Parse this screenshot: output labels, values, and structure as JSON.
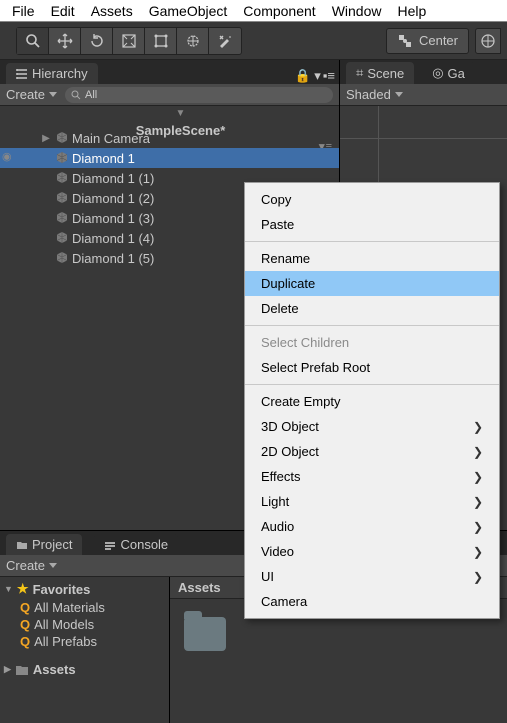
{
  "menubar": [
    "File",
    "Edit",
    "Assets",
    "GameObject",
    "Component",
    "Window",
    "Help"
  ],
  "toolbar": {
    "center_label": "Center"
  },
  "hierarchy": {
    "tab": "Hierarchy",
    "create_label": "Create",
    "search_placeholder": "All",
    "scene": "SampleScene*",
    "nodes": [
      {
        "label": "Main Camera",
        "selected": false,
        "has_arrow": true
      },
      {
        "label": "Diamond 1",
        "selected": true,
        "has_arrow": false
      },
      {
        "label": "Diamond 1 (1)",
        "selected": false,
        "has_arrow": false
      },
      {
        "label": "Diamond 1 (2)",
        "selected": false,
        "has_arrow": false
      },
      {
        "label": "Diamond 1 (3)",
        "selected": false,
        "has_arrow": false
      },
      {
        "label": "Diamond 1 (4)",
        "selected": false,
        "has_arrow": false
      },
      {
        "label": "Diamond 1 (5)",
        "selected": false,
        "has_arrow": false
      }
    ]
  },
  "scene_panel": {
    "tab": "Scene",
    "g_tab": "Ga",
    "shading": "Shaded"
  },
  "project": {
    "tab1": "Project",
    "tab2": "Console",
    "create_label": "Create",
    "favorites_label": "Favorites",
    "fav_items": [
      "All Materials",
      "All Models",
      "All Prefabs"
    ],
    "assets_label": "Assets",
    "assets_breadcrumb": "Assets"
  },
  "context_menu": {
    "groups": [
      [
        {
          "label": "Copy"
        },
        {
          "label": "Paste"
        }
      ],
      [
        {
          "label": "Rename"
        },
        {
          "label": "Duplicate",
          "hl": true
        },
        {
          "label": "Delete"
        }
      ],
      [
        {
          "label": "Select Children",
          "disabled": true
        },
        {
          "label": "Select Prefab Root"
        }
      ],
      [
        {
          "label": "Create Empty"
        },
        {
          "label": "3D Object",
          "sub": true
        },
        {
          "label": "2D Object",
          "sub": true
        },
        {
          "label": "Effects",
          "sub": true
        },
        {
          "label": "Light",
          "sub": true
        },
        {
          "label": "Audio",
          "sub": true
        },
        {
          "label": "Video",
          "sub": true
        },
        {
          "label": "UI",
          "sub": true
        },
        {
          "label": "Camera"
        }
      ]
    ]
  }
}
